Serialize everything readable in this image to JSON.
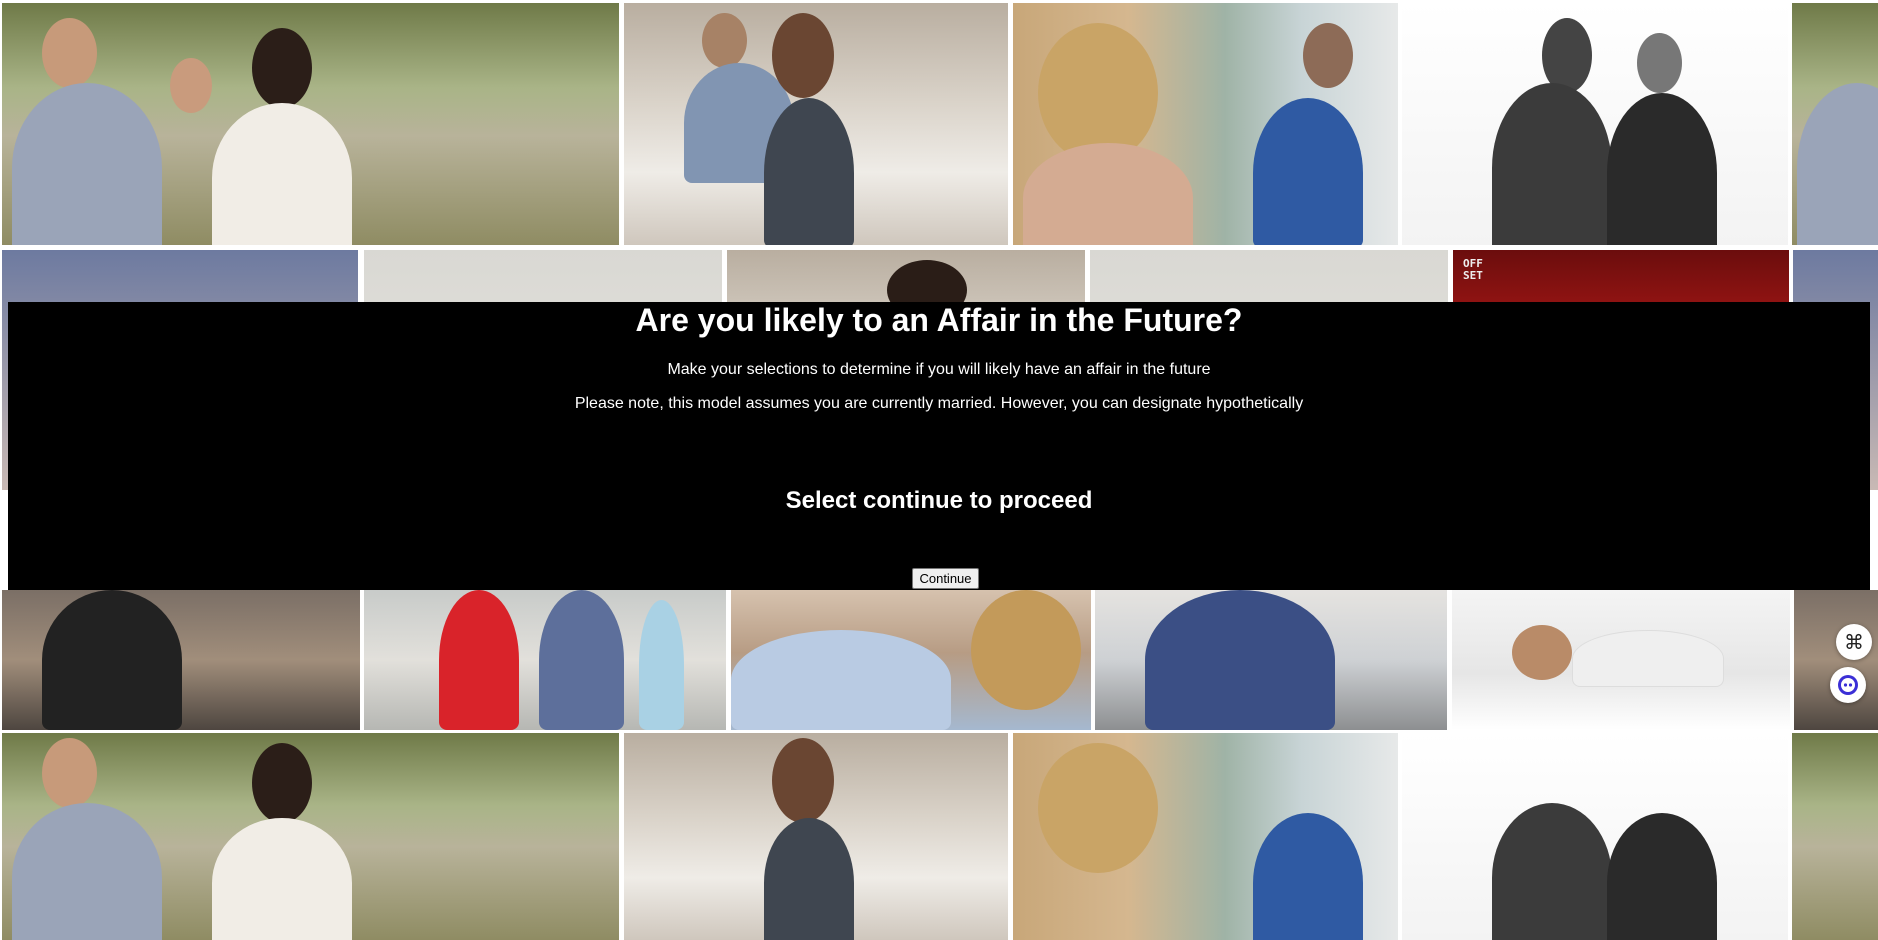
{
  "modal": {
    "title": "Are you likely to an Affair in the Future?",
    "subtitle": "Make your selections to determine if you will likely have an affair in the future",
    "note": "Please note, this model assumes you are currently married. However, you can designate hypothetically",
    "proceed_text": "Select continue to proceed",
    "continue_label": "Continue"
  },
  "tile_overlay_text": "OFF SET",
  "floating": {
    "top_icon": "command-icon",
    "bottom_icon": "chat-bot-icon"
  }
}
